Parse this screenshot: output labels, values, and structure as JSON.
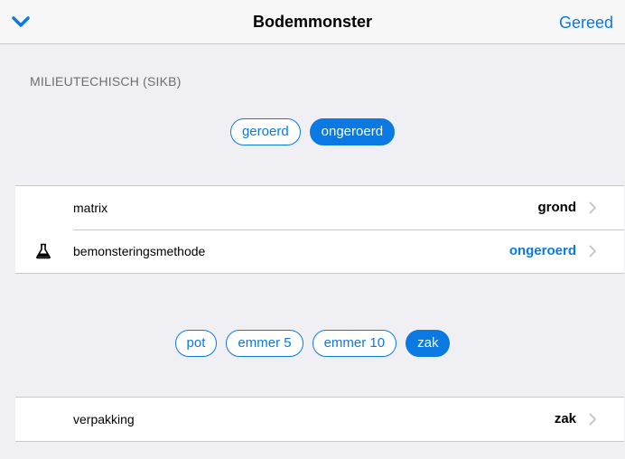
{
  "nav": {
    "title": "Bodemmonster",
    "done_label": "Gereed",
    "back_icon": "chevron-down-icon"
  },
  "section": {
    "header": "MILIEUTECHISCH (SIKB)"
  },
  "sampling_options": [
    {
      "label": "geroerd",
      "selected": false
    },
    {
      "label": "ongeroerd",
      "selected": true
    }
  ],
  "rows_main": [
    {
      "label": "matrix",
      "value": "grond",
      "icon": ""
    },
    {
      "label": "bemonsteringsmethode",
      "value": "ongeroerd",
      "icon": "flask-icon"
    }
  ],
  "packaging_options": [
    {
      "label": "pot",
      "selected": false
    },
    {
      "label": "emmer 5",
      "selected": false
    },
    {
      "label": "emmer 10",
      "selected": false
    },
    {
      "label": "zak",
      "selected": true
    }
  ],
  "rows_packaging": [
    {
      "label": "verpakking",
      "value": "zak",
      "icon": ""
    }
  ],
  "colors": {
    "accent": "#0a7ae2",
    "background": "#efeff4",
    "separator": "#c8c7cc"
  }
}
